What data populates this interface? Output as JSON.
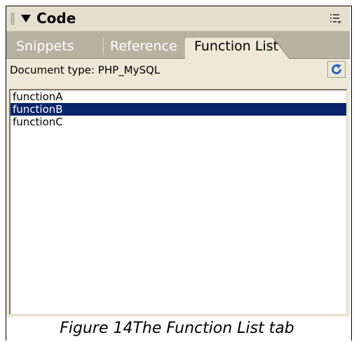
{
  "panel": {
    "title": "Code",
    "icons": {
      "grip": "grip-icon",
      "collapse": "triangle-down-icon",
      "options": "options-menu-icon"
    }
  },
  "tabs": [
    {
      "label": "Snippets",
      "active": false
    },
    {
      "label": "Reference",
      "active": false
    },
    {
      "label": "Function List",
      "active": true
    }
  ],
  "doctype": {
    "label": "Document type: PHP_MySQL"
  },
  "refresh": {
    "icon": "refresh-icon"
  },
  "functions": [
    {
      "name": "functionA",
      "selected": false
    },
    {
      "name": "functionB",
      "selected": true
    },
    {
      "name": "functionC",
      "selected": false
    }
  ],
  "caption": "Figure 14The Function List tab",
  "colors": {
    "selection": "#0a246a",
    "tabbar": "#b5b2a2",
    "panel": "#ece9d8",
    "refresh_blue": "#2f63c7"
  }
}
